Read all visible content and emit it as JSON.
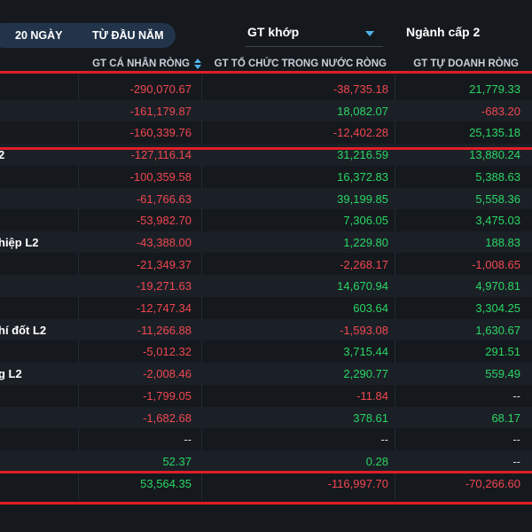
{
  "tabs": [
    {
      "label": "20 NGÀY"
    },
    {
      "label": "TỪ ĐẦU NĂM"
    }
  ],
  "dropdowns": {
    "value_type": "GT khớp",
    "industry_level": "Ngành cấp 2"
  },
  "columns": {
    "individual": "GT CÁ NHÂN RÒNG",
    "institution": "GT TỔ CHỨC TRONG NƯỚC RÒNG",
    "proprietary": "GT TỰ DOANH RÒNG"
  },
  "rows": [
    {
      "name": "",
      "individual": "-290,070.67",
      "institution": "-38,735.18",
      "proprietary": "21,779.33"
    },
    {
      "name": "",
      "individual": "-161,179.87",
      "institution": "18,082.07",
      "proprietary": "-683.20"
    },
    {
      "name": "",
      "individual": "-160,339.76",
      "institution": "-12,402.28",
      "proprietary": "25,135.18"
    },
    {
      "name": "2",
      "individual": "-127,116.14",
      "institution": "31,216.59",
      "proprietary": "13,880.24"
    },
    {
      "name": "",
      "individual": "-100,359.58",
      "institution": "16,372.83",
      "proprietary": "5,388.63"
    },
    {
      "name": "",
      "individual": "-61,766.63",
      "institution": "39,199.85",
      "proprietary": "5,558.36"
    },
    {
      "name": "",
      "individual": "-53,982.70",
      "institution": "7,306.05",
      "proprietary": "3,475.03"
    },
    {
      "name": "hiệp L2",
      "individual": "-43,388.00",
      "institution": "1,229.80",
      "proprietary": "188.83"
    },
    {
      "name": "",
      "individual": "-21,349.37",
      "institution": "-2,268.17",
      "proprietary": "-1,008.65"
    },
    {
      "name": "",
      "individual": "-19,271.63",
      "institution": "14,670.94",
      "proprietary": "4,970.81"
    },
    {
      "name": "",
      "individual": "-12,747.34",
      "institution": "603.64",
      "proprietary": "3,304.25"
    },
    {
      "name": "hí đốt L2",
      "individual": "-11,266.88",
      "institution": "-1,593.08",
      "proprietary": "1,630.67"
    },
    {
      "name": "",
      "individual": "-5,012.32",
      "institution": "3,715.44",
      "proprietary": "291.51"
    },
    {
      "name": "g L2",
      "individual": "-2,008.46",
      "institution": "2,290.77",
      "proprietary": "559.49"
    },
    {
      "name": "",
      "individual": "-1,799.05",
      "institution": "-11.84",
      "proprietary": "--"
    },
    {
      "name": "",
      "individual": "-1,682.68",
      "institution": "378.61",
      "proprietary": "68.17"
    },
    {
      "name": "",
      "individual": "--",
      "institution": "--",
      "proprietary": "--"
    },
    {
      "name": "",
      "individual": "52.37",
      "institution": "0.28",
      "proprietary": "--"
    },
    {
      "name": "",
      "individual": "53,564.35",
      "institution": "-116,997.70",
      "proprietary": "-70,266.60"
    }
  ],
  "colors": {
    "negative": "#f0474f",
    "positive": "#2bd663",
    "neutral": "#d7dbe1",
    "highlight": "#e01e27",
    "accent": "#4fb3ea"
  }
}
